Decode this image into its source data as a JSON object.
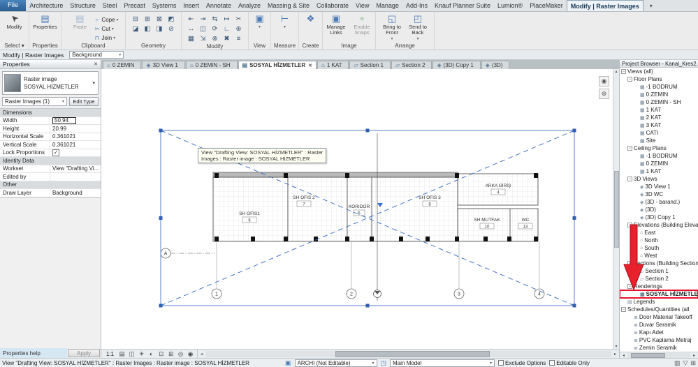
{
  "ui": {
    "caret": "▾",
    "up": "▴",
    "down": "▾",
    "left": "◂",
    "right": "▸",
    "wheel_glyph": "◉",
    "zoom_glyph": "⊕",
    "worksets_glyph": "▣",
    "design_options_glyph": "◳"
  },
  "ribbon": {
    "file_tab": "File",
    "tabs": [
      "Architecture",
      "Structure",
      "Steel",
      "Precast",
      "Systems",
      "Insert",
      "Annotate",
      "Analyze",
      "Massing & Site",
      "Collaborate",
      "View",
      "Manage",
      "Add-Ins",
      "Knauf Planner Suite",
      "Lumion®",
      "PlaceMaker"
    ],
    "active_tab": "Modify | Raster Images",
    "state_toggle": "▾",
    "modify_button": "Modify",
    "properties_button": "Properties",
    "paste_button": "Paste",
    "cope": "Cope",
    "cut": "Cut",
    "join": "Join",
    "manage_links": "Manage Links",
    "enable_snaps": "Enable Snaps",
    "bring_front": "Bring to Front",
    "send_back": "Send to Back",
    "panel_labels": [
      "Select ▾",
      "Properties",
      "Clipboard",
      "Geometry",
      "Modify",
      "View",
      "Measure",
      "Create",
      "Image",
      "Arrange"
    ],
    "geometry_tools": [
      {
        "name": "cut-geometry-icon",
        "g": "⊟"
      },
      {
        "name": "join-geometry-icon",
        "g": "⊞"
      },
      {
        "name": "wall-joins-icon",
        "g": "⊠"
      },
      {
        "name": "beam-cope-icon",
        "g": "◩"
      },
      {
        "name": "demolish-icon",
        "g": "◪"
      },
      {
        "name": "paint-icon",
        "g": "◧"
      },
      {
        "name": "split-face-icon",
        "g": "◨"
      },
      {
        "name": "unjoin-geometry-icon",
        "g": "⊘"
      }
    ],
    "modify_tools": [
      {
        "name": "align-icon",
        "g": "⇤"
      },
      {
        "name": "offset-icon",
        "g": "⇥"
      },
      {
        "name": "mirror-icon",
        "g": "⇆"
      },
      {
        "name": "extend-icon",
        "g": "↦"
      },
      {
        "name": "split-icon",
        "g": "✂"
      },
      {
        "name": "move-icon",
        "g": "↔"
      },
      {
        "name": "copy-icon",
        "g": "◫"
      },
      {
        "name": "rotate-icon",
        "g": "⟳"
      },
      {
        "name": "trim-icon",
        "g": "∟"
      },
      {
        "name": "pin-icon",
        "g": "⊕"
      },
      {
        "name": "array-icon",
        "g": "▦"
      },
      {
        "name": "scale-icon",
        "g": "⇲"
      },
      {
        "name": "unpin-icon",
        "g": "⊗"
      },
      {
        "name": "delete-icon",
        "g": "✖"
      },
      {
        "name": "match-type-icon",
        "g": "≡"
      }
    ],
    "view_tool_icon": "▣",
    "measure_tool_icon": "⊢",
    "create_tool_icon": "❖",
    "paste_icon": "▤",
    "cope_icon": "⌐",
    "cut_icon": "✂",
    "join_icon": "⊓",
    "manage_links_icon": "▣",
    "enable_snaps_icon": "⌖",
    "bring_front_icon": "◱",
    "send_back_icon": "◰"
  },
  "options_bar": {
    "mode_label": "Modify | Raster Images",
    "field_value": "Background"
  },
  "properties": {
    "title": "Properties",
    "close": "✕",
    "type_line1": "Raster image",
    "type_line2": "SOSYAL HİZMETLER",
    "filter": "Raster Images (1)",
    "edit_type": "Edit Type",
    "rows": [
      {
        "type": "header",
        "label": "Dimensions"
      },
      {
        "type": "row",
        "label": "Width",
        "value": "50.94",
        "boxed": true
      },
      {
        "type": "row",
        "label": "Height",
        "value": "20.99"
      },
      {
        "type": "row",
        "label": "Horizontal Scale",
        "value": "0.361021"
      },
      {
        "type": "row",
        "label": "Vertical Scale",
        "value": "0.361021"
      },
      {
        "type": "check",
        "label": "Lock Proportions",
        "value": "✓"
      },
      {
        "type": "header",
        "label": "Identity Data"
      },
      {
        "type": "row",
        "label": "Workset",
        "value": "View \"Drafting Vi..."
      },
      {
        "type": "row",
        "label": "Edited by",
        "value": ""
      },
      {
        "type": "header",
        "label": "Other"
      },
      {
        "type": "row",
        "label": "Draw Layer",
        "value": "Background"
      }
    ],
    "help": "Properties help",
    "apply": "Apply"
  },
  "view_tabs": [
    {
      "label": "0 ZEMIN",
      "glyph": "⌂",
      "name": "view-tab-0-zemin"
    },
    {
      "label": "3D View 1",
      "glyph": "◈",
      "name": "view-tab-3d-view-1"
    },
    {
      "label": "0 ZEMIN - SH",
      "glyph": "⌂",
      "name": "view-tab-0-zemin-sh"
    },
    {
      "label": "SOSYAL HİZMETLER",
      "glyph": "▤",
      "close": "✕",
      "active": true,
      "name": "view-tab-sosyal-hizmetler"
    },
    {
      "label": "1 KAT",
      "glyph": "⌂",
      "name": "view-tab-1-kat"
    },
    {
      "label": "Section 1",
      "glyph": "▱",
      "name": "view-tab-section-1"
    },
    {
      "label": "Section 2",
      "glyph": "▱",
      "name": "view-tab-section-2"
    },
    {
      "label": "(3D) Copy 1",
      "glyph": "◈",
      "name": "view-tab-3d-copy-1"
    },
    {
      "label": "(3D)",
      "glyph": "◈",
      "name": "view-tab-3d"
    }
  ],
  "canvas": {
    "tooltip": [
      "View \"Drafting View: SOSYAL HİZMETLER\" : Raster",
      "Images : Raster image : SOSYAL HİZMETLER"
    ],
    "rooms": [
      {
        "name": "SH OFIS1",
        "number": "6"
      },
      {
        "name": "SH OFIS 2",
        "number": "7"
      },
      {
        "name": "KORIDOR",
        "number": "5"
      },
      {
        "name": "SH OFIS 3",
        "number": "8"
      },
      {
        "name": "ARKA GİRİŞ",
        "number": "4"
      },
      {
        "name": "SH MUTFAK",
        "number": "10"
      },
      {
        "name": "WC",
        "number": "13"
      }
    ],
    "grid_bubbles": [
      "1",
      "2",
      "3",
      "4"
    ],
    "grid_row_bubble": "A"
  },
  "project_browser": {
    "title": "Project Browser - Kanal_Kres2...",
    "items": [
      {
        "label": "Views (all)",
        "depth": 0,
        "expander": "−",
        "glyph": "",
        "name": "tree-views-all"
      },
      {
        "label": "Floor Plans",
        "depth": 1,
        "expander": "−",
        "glyph": "",
        "name": "tree-floor-plans"
      },
      {
        "label": "-1 BODRUM",
        "depth": 2,
        "expander": "",
        "glyph": "▦",
        "name": "tree-floorplan-minus1-bodrum"
      },
      {
        "label": "0 ZEMIN",
        "depth": 2,
        "expander": "",
        "glyph": "▦",
        "name": "tree-floorplan-0-zemin"
      },
      {
        "label": "0 ZEMIN - SH",
        "depth": 2,
        "expander": "",
        "glyph": "▦",
        "name": "tree-floorplan-0-zemin-sh"
      },
      {
        "label": "1 KAT",
        "depth": 2,
        "expander": "",
        "glyph": "▦",
        "name": "tree-floorplan-1-kat"
      },
      {
        "label": "2 KAT",
        "depth": 2,
        "expander": "",
        "glyph": "▦",
        "name": "tree-floorplan-2-kat"
      },
      {
        "label": "3 KAT",
        "depth": 2,
        "expander": "",
        "glyph": "▦",
        "name": "tree-floorplan-3-kat"
      },
      {
        "label": "CATI",
        "depth": 2,
        "expander": "",
        "glyph": "▦",
        "name": "tree-floorplan-cati"
      },
      {
        "label": "Site",
        "depth": 2,
        "expander": "",
        "glyph": "▦",
        "name": "tree-floorplan-site"
      },
      {
        "label": "Ceiling Plans",
        "depth": 1,
        "expander": "−",
        "glyph": "",
        "name": "tree-ceiling-plans"
      },
      {
        "label": "-1 BODRUM",
        "depth": 2,
        "expander": "",
        "glyph": "▦",
        "name": "tree-ceiling-minus1-bodrum"
      },
      {
        "label": "0 ZEMIN",
        "depth": 2,
        "expander": "",
        "glyph": "▦",
        "name": "tree-ceiling-0-zemin"
      },
      {
        "label": "1 KAT",
        "depth": 2,
        "expander": "",
        "glyph": "▦",
        "name": "tree-ceiling-1-kat"
      },
      {
        "label": "3D Views",
        "depth": 1,
        "expander": "−",
        "glyph": "",
        "name": "tree-3d-views"
      },
      {
        "label": "3D View 1",
        "depth": 2,
        "expander": "",
        "glyph": "◈",
        "name": "tree-3d-view-1"
      },
      {
        "label": "3D WC",
        "depth": 2,
        "expander": "",
        "glyph": "◈",
        "name": "tree-3d-wc"
      },
      {
        "label": "(3D - barand.)",
        "depth": 2,
        "expander": "",
        "glyph": "◈",
        "name": "tree-3d-barand"
      },
      {
        "label": "(3D)",
        "depth": 2,
        "expander": "",
        "glyph": "◈",
        "name": "tree-3d"
      },
      {
        "label": "(3D) Copy 1",
        "depth": 2,
        "expander": "",
        "glyph": "◈",
        "name": "tree-3d-copy-1"
      },
      {
        "label": "Elevations (Building Elevat",
        "depth": 1,
        "expander": "−",
        "glyph": "",
        "name": "tree-elevations"
      },
      {
        "label": "East",
        "depth": 2,
        "expander": "",
        "glyph": "⌂",
        "name": "tree-elevation-east"
      },
      {
        "label": "North",
        "depth": 2,
        "expander": "",
        "glyph": "⌂",
        "name": "tree-elevation-north"
      },
      {
        "label": "South",
        "depth": 2,
        "expander": "",
        "glyph": "⌂",
        "name": "tree-elevation-south"
      },
      {
        "label": "West",
        "depth": 2,
        "expander": "",
        "glyph": "⌂",
        "name": "tree-elevation-west"
      },
      {
        "label": "Sections (Building Section",
        "depth": 1,
        "expander": "−",
        "glyph": "",
        "name": "tree-sections"
      },
      {
        "label": "Section 1",
        "depth": 2,
        "expander": "",
        "glyph": "▱",
        "name": "tree-section-1"
      },
      {
        "label": "Section 2",
        "depth": 2,
        "expander": "",
        "glyph": "▱",
        "name": "tree-section-2"
      },
      {
        "label": "Renderings",
        "depth": 1,
        "expander": "−",
        "glyph": "",
        "name": "tree-renderings"
      },
      {
        "label": "SOSYAL HİZMETLER",
        "depth": 2,
        "expander": "",
        "glyph": "▩",
        "selected": true,
        "name": "tree-rendering-sosyal-hizmetler"
      },
      {
        "label": "Legends",
        "depth": 0,
        "expander": "",
        "glyph": "▤",
        "name": "tree-legends"
      },
      {
        "label": "Schedules/Quantities (all",
        "depth": 0,
        "expander": "−",
        "glyph": "",
        "name": "tree-schedules"
      },
      {
        "label": "Door Material Takeoff",
        "depth": 1,
        "expander": "",
        "glyph": "≣",
        "name": "tree-schedule-door-material-takeoff"
      },
      {
        "label": "Duvar Seramik",
        "depth": 1,
        "expander": "",
        "glyph": "≣",
        "name": "tree-schedule-duvar-seramik"
      },
      {
        "label": "Kapı Adet",
        "depth": 1,
        "expander": "",
        "glyph": "≣",
        "name": "tree-schedule-kapi-adet"
      },
      {
        "label": "PVC Kaplama Metraj",
        "depth": 1,
        "expander": "",
        "glyph": "≣",
        "name": "tree-schedule-pvc-kaplama-metraj"
      },
      {
        "label": "Zemin Seramik",
        "depth": 1,
        "expander": "",
        "glyph": "≣",
        "name": "tree-schedule-zemin-seramik"
      }
    ]
  },
  "status": {
    "scale": "1:1",
    "text": "View \"Drafting View: SOSYAL HİZMETLER\" : Raster Images : Raster image : SOSYAL HİZMETLER",
    "workset": "ARCHI (Not Editable)",
    "design_option": "Main Model",
    "exclude_options": "Exclude Options",
    "editable_only": "Editable Only",
    "view_controls": [
      {
        "name": "detail-level-icon",
        "g": "▤"
      },
      {
        "name": "visual-style-icon",
        "g": "◫"
      },
      {
        "name": "sun-path-icon",
        "g": "☀"
      },
      {
        "name": "shadows-icon",
        "g": "◐"
      },
      {
        "name": "crop-view-icon",
        "g": "⊡"
      },
      {
        "name": "show-crop-region-icon",
        "g": "⊞"
      },
      {
        "name": "temporary-hide-isolate-icon",
        "g": "◎"
      },
      {
        "name": "reveal-hidden-elements-icon",
        "g": "◉"
      }
    ],
    "right_icons": [
      {
        "name": "worksharing-display-icon",
        "g": "▥"
      },
      {
        "name": "selection-filter-icon",
        "g": "▽"
      },
      {
        "name": "select-toggle-icon",
        "g": "⊞"
      }
    ]
  },
  "accent_colors": {
    "selection_blue": "#4472c4",
    "annotation_red": "#e8212d"
  }
}
